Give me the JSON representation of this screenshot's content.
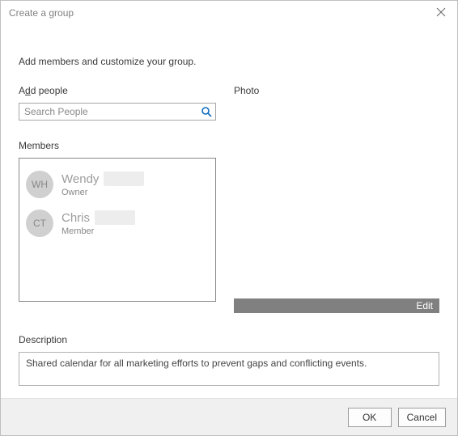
{
  "dialog": {
    "title": "Create a group",
    "instruction": "Add members and customize your group."
  },
  "addPeople": {
    "label_pre": "A",
    "label_ul": "d",
    "label_post": "d people"
  },
  "search": {
    "placeholder": "Search People",
    "value": ""
  },
  "photo": {
    "label": "Photo",
    "edit_label": "Edit"
  },
  "membersSection": {
    "label": "Members"
  },
  "members": [
    {
      "initials": "WH",
      "name": "Wendy",
      "role": "Owner"
    },
    {
      "initials": "CT",
      "name": "Chris",
      "role": "Member"
    }
  ],
  "description": {
    "label": "Description",
    "value": "Shared calendar for all marketing efforts to prevent gaps and conflicting events."
  },
  "buttons": {
    "ok": "OK",
    "cancel": "Cancel"
  }
}
